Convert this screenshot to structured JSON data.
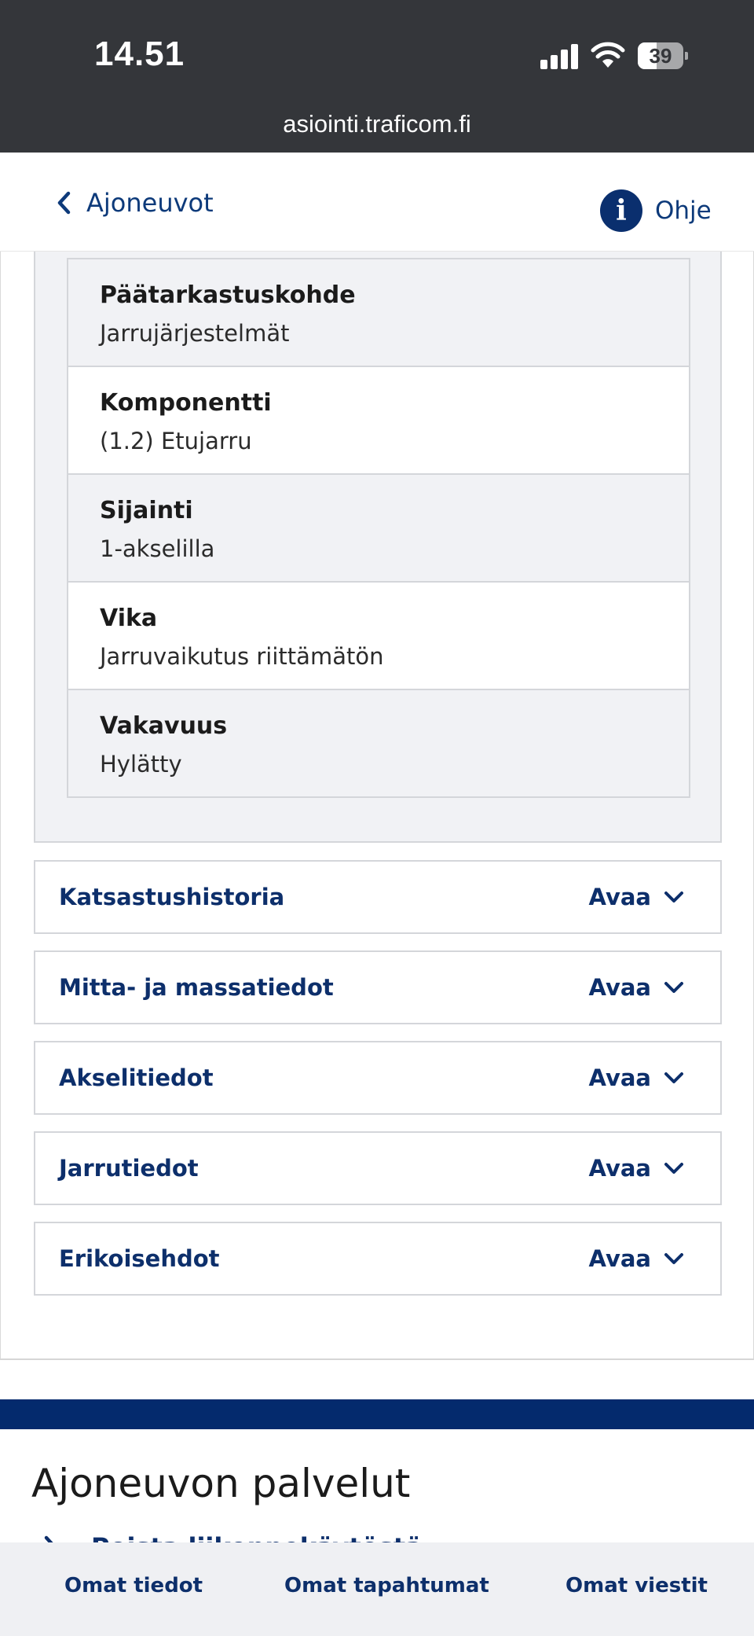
{
  "status_bar": {
    "time": "14.51",
    "battery": "39"
  },
  "browser": {
    "url": "asiointi.traficom.fi"
  },
  "header": {
    "back_label": "Ajoneuvot",
    "help_label": "Ohje"
  },
  "defect": {
    "rows": [
      {
        "label": "Päätarkastuskohde",
        "value": "Jarrujärjestelmät"
      },
      {
        "label": "Komponentti",
        "value": "(1.2) Etujarru"
      },
      {
        "label": "Sijainti",
        "value": "1-akselilla"
      },
      {
        "label": "Vika",
        "value": "Jarruvaikutus riittämätön"
      },
      {
        "label": "Vakavuus",
        "value": "Hylätty"
      }
    ]
  },
  "accordions": {
    "open_label": "Avaa",
    "items": [
      {
        "title": "Katsastushistoria"
      },
      {
        "title": "Mitta- ja massatiedot"
      },
      {
        "title": "Akselitiedot"
      },
      {
        "title": "Jarrutiedot"
      },
      {
        "title": "Erikoisehdot"
      }
    ]
  },
  "services": {
    "title": "Ajoneuvon palvelut",
    "first_item": "Poista liikennekäytöstä"
  },
  "bottom_nav": {
    "items": [
      {
        "label": "Omat tiedot"
      },
      {
        "label": "Omat tapahtumat"
      },
      {
        "label": "Omat viestit"
      }
    ]
  },
  "colors": {
    "brand_navy": "#0d2f6b",
    "strip_blue": "#042a6d",
    "panel_gray": "#f1f2f5"
  }
}
